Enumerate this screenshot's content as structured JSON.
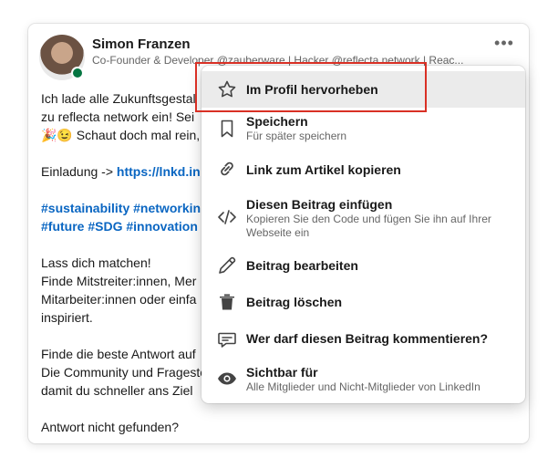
{
  "post": {
    "author_name": "Simon Franzen",
    "author_headline": "Co-Founder & Developer @zauberware | Hacker @reflecta.network | Reac...",
    "more_label": "•••",
    "lines": [
      "Ich lade alle Zukunftsgestal",
      "zu reflecta network ein! Sei",
      "🎉😉 Schaut doch mal rein,",
      "",
      "Einladung -> ",
      "",
      "#sustainability #networkin",
      "#future #SDG #innovation",
      "",
      "Lass dich matchen!",
      "Finde Mitstreiter:innen, Mer",
      "Mitarbeiter:innen oder einfa",
      "inspiriert.",
      "",
      "Finde die beste Antwort auf",
      "Die Community und Frageste",
      "damit du schneller ans Ziel",
      "",
      "Antwort nicht gefunden?"
    ],
    "invite_link": "https://lnkd.in"
  },
  "menu": {
    "items": [
      {
        "icon": "star-icon",
        "title": "Im Profil hervorheben",
        "subtitle": ""
      },
      {
        "icon": "bookmark-icon",
        "title": "Speichern",
        "subtitle": "Für später speichern"
      },
      {
        "icon": "link-icon",
        "title": "Link zum Artikel kopieren",
        "subtitle": ""
      },
      {
        "icon": "code-icon",
        "title": "Diesen Beitrag einfügen",
        "subtitle": "Kopieren Sie den Code und fügen Sie ihn auf Ihrer Webseite ein"
      },
      {
        "icon": "pencil-icon",
        "title": "Beitrag bearbeiten",
        "subtitle": ""
      },
      {
        "icon": "trash-icon",
        "title": "Beitrag löschen",
        "subtitle": ""
      },
      {
        "icon": "comment-icon",
        "title": "Wer darf diesen Beitrag kommentieren?",
        "subtitle": ""
      },
      {
        "icon": "eye-icon",
        "title": "Sichtbar für",
        "subtitle": "Alle Mitglieder und Nicht-Mitglieder von LinkedIn"
      }
    ]
  },
  "colors": {
    "link": "#0a66c2",
    "highlight_box": "#d93025",
    "presence": "#057642"
  }
}
